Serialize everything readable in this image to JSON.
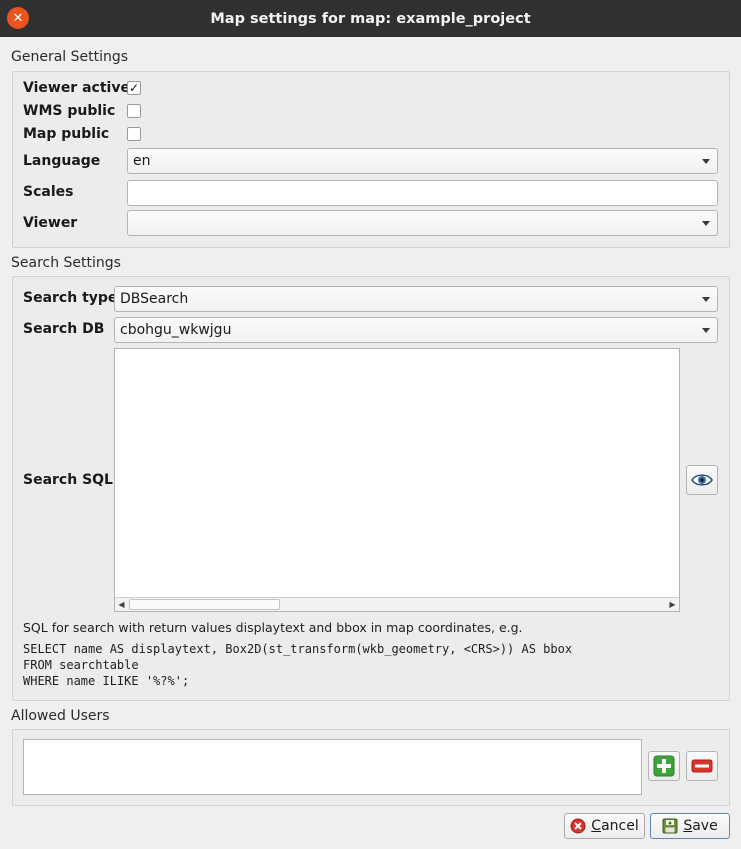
{
  "window": {
    "title": "Map settings for map: example_project"
  },
  "general": {
    "title": "General Settings",
    "viewer_active": {
      "label": "Viewer active",
      "checked": true,
      "mark": "✓"
    },
    "wms_public": {
      "label": "WMS public",
      "checked": false
    },
    "map_public": {
      "label": "Map public",
      "checked": false
    },
    "language": {
      "label": "Language",
      "value": "en"
    },
    "scales": {
      "label": "Scales",
      "value": ""
    },
    "viewer": {
      "label": "Viewer",
      "value": ""
    }
  },
  "search": {
    "title": "Search Settings",
    "type": {
      "label": "Search type",
      "value": "DBSearch"
    },
    "db": {
      "label": "Search DB",
      "value": "cbohgu_wkwjgu"
    },
    "sql": {
      "label": "Search SQL",
      "value": ""
    },
    "hint": "SQL for search with return values displaytext and bbox in map coordinates, e.g.",
    "example_lines": [
      "SELECT name AS displaytext, Box2D(st_transform(wkb_geometry, <CRS>)) AS bbox",
      "FROM searchtable",
      "WHERE name ILIKE '%?%';"
    ]
  },
  "users": {
    "title": "Allowed Users"
  },
  "buttons": {
    "cancel_first": "C",
    "cancel_rest": "ancel",
    "save_first": "S",
    "save_rest": "ave"
  },
  "icons": {
    "close": "close-icon",
    "preview": "eye-icon",
    "add": "plus-icon",
    "remove": "minus-icon",
    "cancel": "cancel-icon",
    "save": "save-icon"
  },
  "colors": {
    "accent_green": "#3ea33a",
    "accent_red": "#d9342c",
    "close_orange": "#e9541f"
  }
}
